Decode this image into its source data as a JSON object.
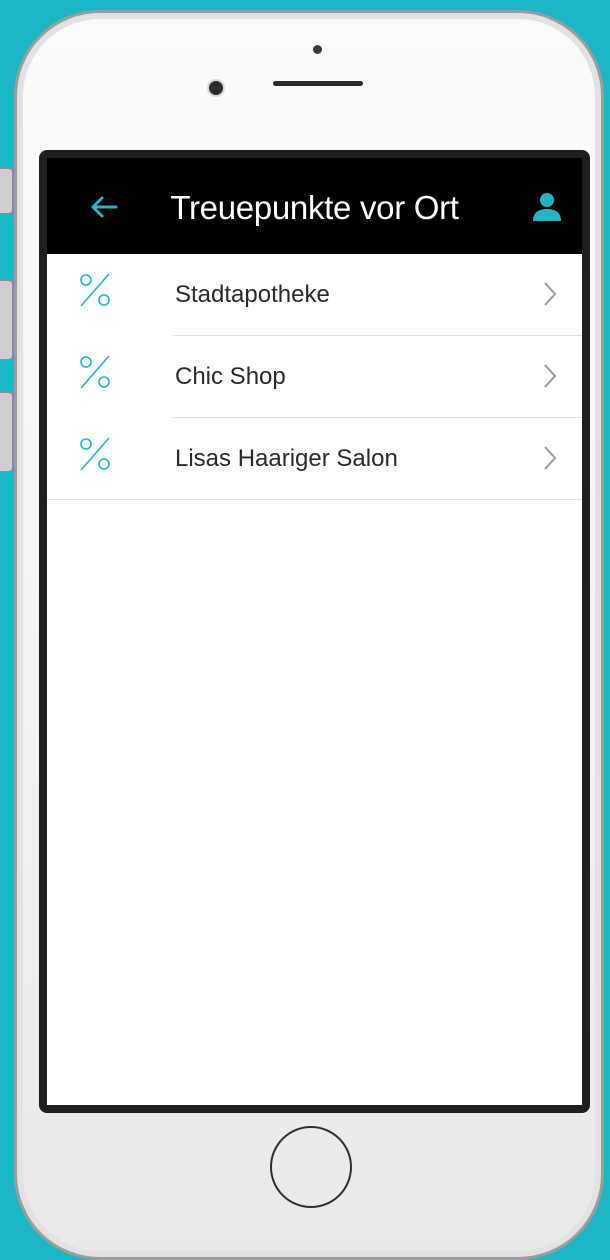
{
  "header": {
    "title": "Treuepunkte vor Ort"
  },
  "icons": {
    "back": "arrow-left-icon",
    "profile": "user-icon",
    "item": "percent-icon",
    "chevron": "chevron-right-icon"
  },
  "colors": {
    "accent": "#26b3c6",
    "header_bg": "#000000",
    "background": "#1cb6c4"
  },
  "list": {
    "items": [
      {
        "label": "Stadtapotheke"
      },
      {
        "label": "Chic Shop"
      },
      {
        "label": "Lisas Haariger Salon"
      }
    ]
  }
}
